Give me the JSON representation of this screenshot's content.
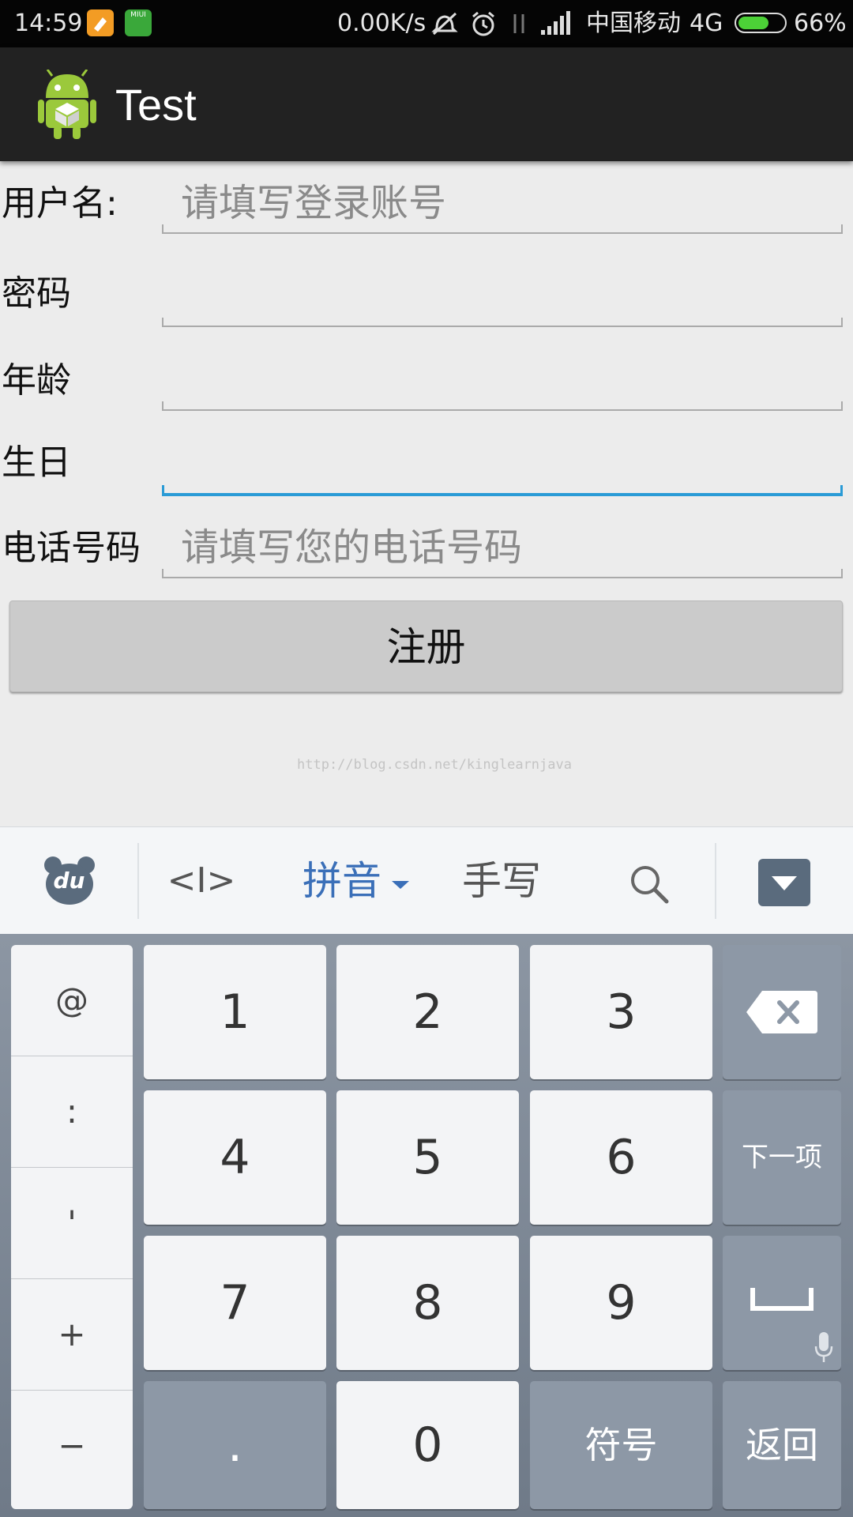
{
  "status_bar": {
    "time": "14:59",
    "notif_icon_1": "task-icon",
    "notif_icon_2": "miui-icon",
    "notif_icon_2_label": "MIUI",
    "net_speed": "0.00K/s",
    "carrier": "中国移动",
    "network_type": "4G",
    "battery": "66%",
    "battery_fraction": 0.66,
    "battery_color": "#4cd137"
  },
  "action_bar": {
    "title": "Test",
    "icon": "android-icon"
  },
  "form": {
    "username_label": "用户名:",
    "username_placeholder": "请填写登录账号",
    "password_label": "密码",
    "age_label": "年龄",
    "birthday_label": "生日",
    "phone_label": "电话号码",
    "phone_placeholder": "请填写您的电话号码",
    "register_label": "注册",
    "focus_color": "#2a9bd6"
  },
  "watermark": "http://blog.csdn.net/kinglearnjava",
  "ime_toolbar": {
    "logo": "du-bear-icon",
    "logo_text": "du",
    "cursor_tool": "<I>",
    "pinyin": "拼音",
    "handwriting": "手写",
    "search": "search-icon",
    "hide": "hide-keyboard-icon",
    "accent_color": "#3a6fb8"
  },
  "keyboard": {
    "symbols": [
      "@",
      ":",
      "'",
      "+",
      "−"
    ],
    "digits": [
      "1",
      "2",
      "3",
      "4",
      "5",
      "6",
      "7",
      "8",
      "9"
    ],
    "dot": ".",
    "zero": "0",
    "next_label": "下一项",
    "symbol_label": "符号",
    "return_label": "返回",
    "backspace": "backspace-icon",
    "space": "space-icon",
    "mic": "microphone-icon"
  }
}
